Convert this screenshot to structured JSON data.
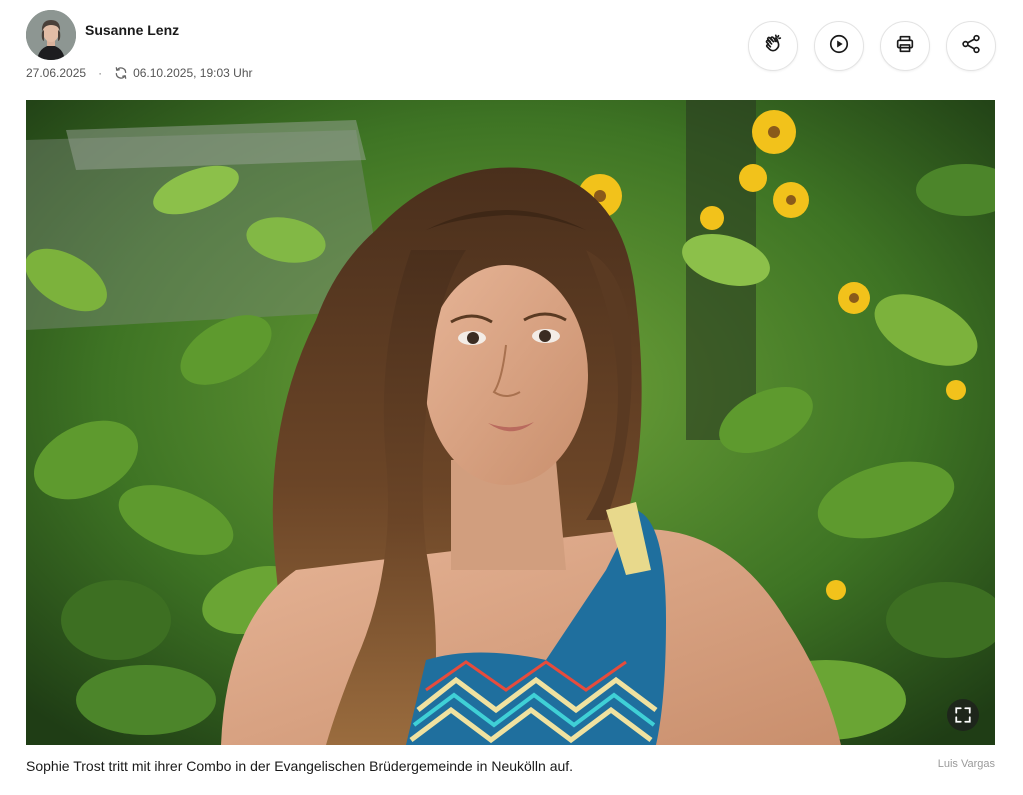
{
  "author": {
    "name": "Susanne Lenz",
    "avatar_icon": "author-portrait"
  },
  "meta": {
    "published": "27.06.2025",
    "separator": "·",
    "updated": "06.10.2025, 19:03 Uhr",
    "updated_icon": "refresh-icon"
  },
  "actions": [
    {
      "icon": "clap-icon",
      "label": "Applaus"
    },
    {
      "icon": "play-icon",
      "label": "Vorlesen"
    },
    {
      "icon": "print-icon",
      "label": "Drucken"
    },
    {
      "icon": "share-icon",
      "label": "Teilen"
    }
  ],
  "image": {
    "fullscreen_icon": "fullscreen-icon",
    "caption": "Sophie Trost tritt mit ihrer Combo in der Evangelischen Brüdergemeinde in Neukölln auf.",
    "credit": "Luis Vargas"
  },
  "colors": {
    "text": "#1a1a1a",
    "meta": "#555555",
    "credit": "#9a9a9a",
    "button_border": "#e3e3e3"
  }
}
